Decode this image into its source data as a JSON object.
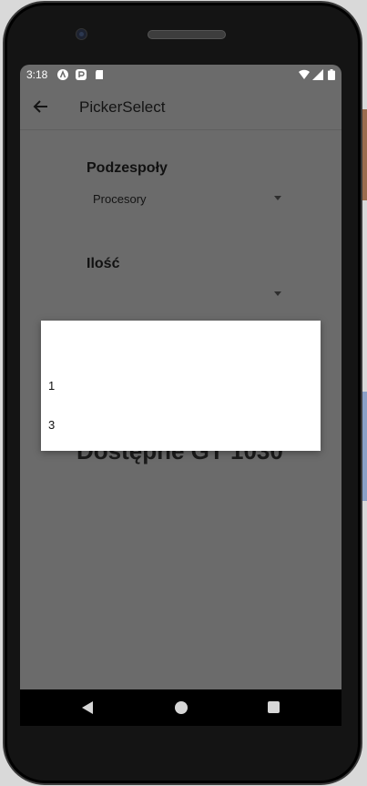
{
  "status_bar": {
    "time": "3:18",
    "icons": [
      "app-a-icon",
      "app-p-icon",
      "sd-card-icon",
      "wifi-icon",
      "signal-icon",
      "battery-icon"
    ]
  },
  "toolbar": {
    "back_icon": "arrow-left-icon",
    "title": "PickerSelect"
  },
  "form": {
    "components_label": "Podzespoły",
    "components_value": "Procesory",
    "quantity_label": "Ilość",
    "quantity_value": ""
  },
  "availability_text": "Dostępne GT 1030",
  "dropdown": {
    "options": [
      "",
      "1",
      "3"
    ]
  },
  "nav_bar": {
    "icons": [
      "nav-back-icon",
      "nav-home-icon",
      "nav-recents-icon"
    ]
  },
  "colors": {
    "scrim_screen": "#6b6b6b",
    "phone_frame": "#141414",
    "dropdown_bg": "#ffffff"
  }
}
